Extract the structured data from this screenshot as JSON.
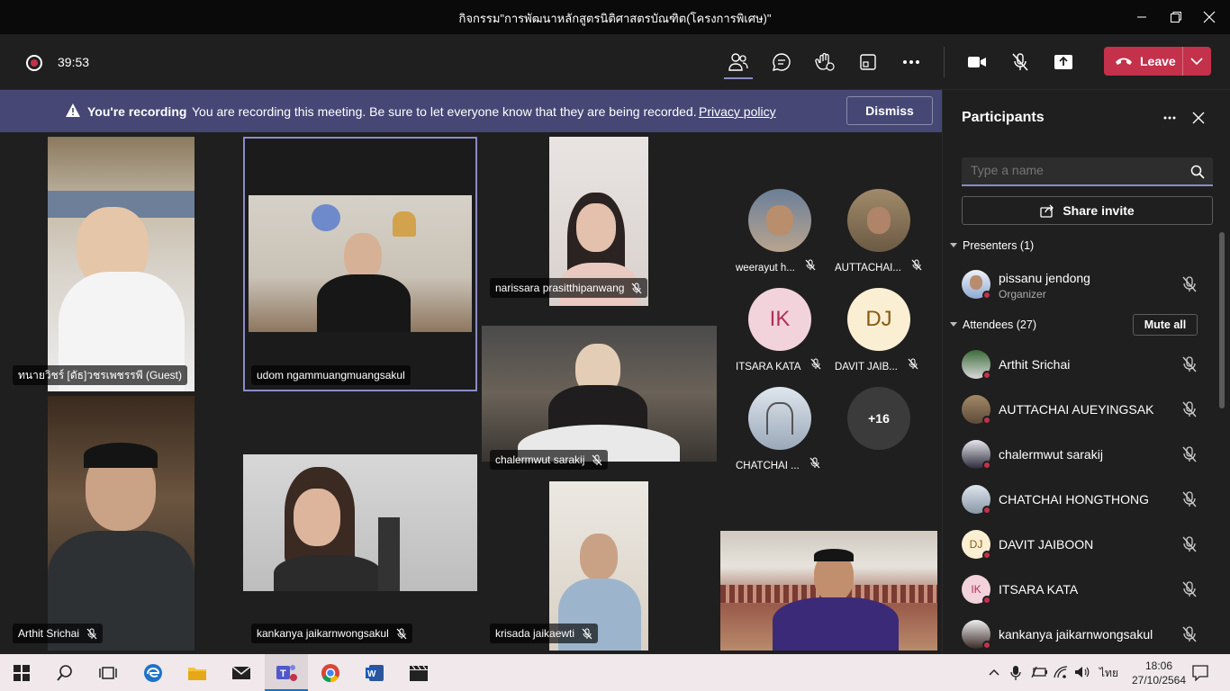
{
  "window": {
    "title": "กิจกรรม\"การพัฒนาหลักสูตรนิติศาสตรบัณฑิต(โครงการพิเศษ)\""
  },
  "meeting": {
    "timer": "39:53",
    "leave_label": "Leave",
    "accent": "#c4314b"
  },
  "banner": {
    "bold": "You're recording",
    "message": "You are recording this meeting. Be sure to let everyone know that they are being recorded.",
    "link": "Privacy policy",
    "dismiss": "Dismiss"
  },
  "videos": [
    {
      "name": "ทนายวิชร์ [ดัธ]วชรเพชรรพี (Guest)"
    },
    {
      "name": "udom ngammuangmuangsakul"
    },
    {
      "name": "narissara prasitthipanwang"
    },
    {
      "name": "chalermwut sarakij"
    },
    {
      "name": "Arthit Srichai"
    },
    {
      "name": "kankanya jaikarnwongsakul"
    },
    {
      "name": "krisada jaikaewti"
    }
  ],
  "gallery": [
    {
      "name": "weerayut h...",
      "initials": ""
    },
    {
      "name": "AUTTACHAI...",
      "initials": ""
    },
    {
      "name": "ITSARA KATA",
      "initials": "IK"
    },
    {
      "name": "DAVIT JAIB...",
      "initials": "DJ"
    },
    {
      "name": "CHATCHAI ...",
      "initials": ""
    },
    {
      "name": "",
      "initials": "+16"
    }
  ],
  "panel": {
    "title": "Participants",
    "search_placeholder": "Type a name",
    "share_invite": "Share invite",
    "presenters_label": "Presenters (1)",
    "attendees_label": "Attendees (27)",
    "mute_all": "Mute all",
    "presenters": [
      {
        "name": "pissanu jendong",
        "role": "Organizer"
      }
    ],
    "attendees": [
      {
        "name": "Arthit Srichai",
        "initials": ""
      },
      {
        "name": "AUTTACHAI AUEYINGSAK",
        "initials": ""
      },
      {
        "name": "chalermwut sarakij",
        "initials": ""
      },
      {
        "name": "CHATCHAI HONGTHONG",
        "initials": ""
      },
      {
        "name": "DAVIT JAIBOON",
        "initials": "DJ"
      },
      {
        "name": "ITSARA KATA",
        "initials": "IK"
      },
      {
        "name": "kankanya jaikarnwongsakul",
        "initials": ""
      }
    ]
  },
  "taskbar": {
    "lang": "ไทย",
    "time": "18:06",
    "date": "27/10/2564"
  }
}
